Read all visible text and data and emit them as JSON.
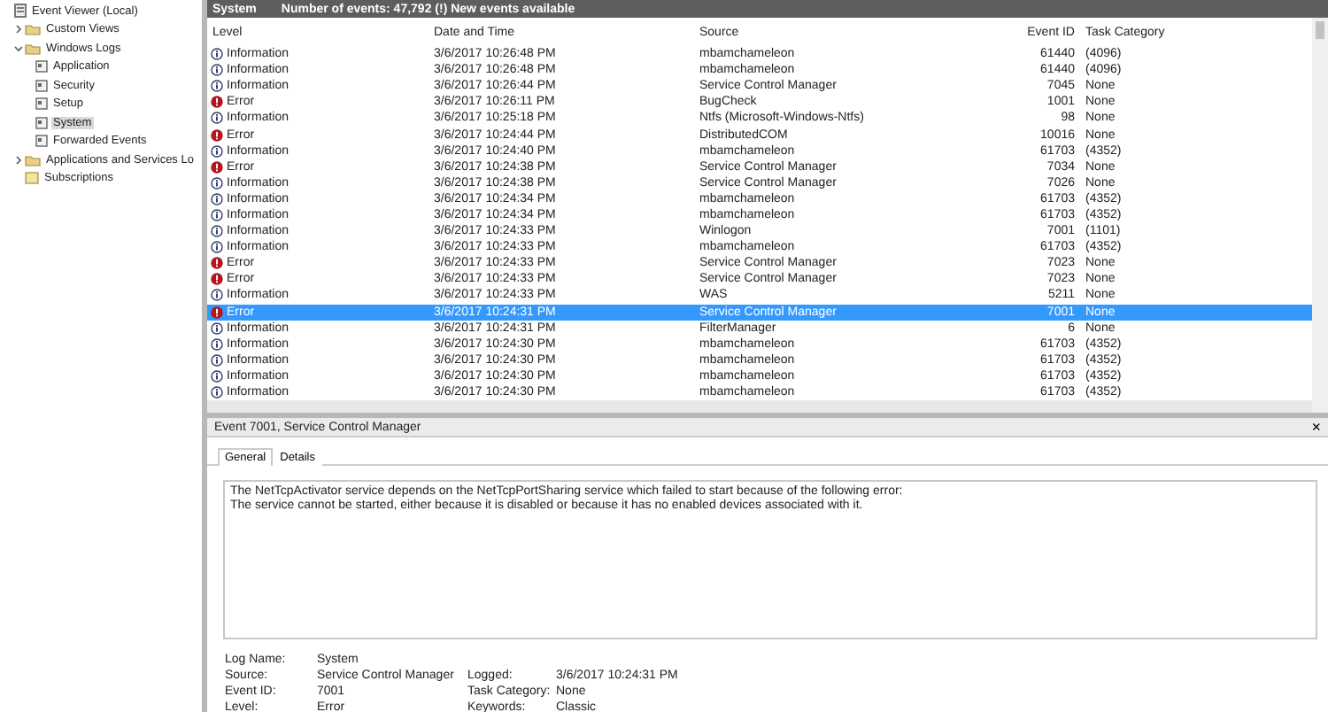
{
  "tree": [
    {
      "label": "Event Viewer (Local)",
      "kind": "viewer",
      "children": [
        {
          "label": "Custom Views",
          "kind": "folder",
          "expanded": false
        },
        {
          "label": "Windows Logs",
          "kind": "folder",
          "expanded": true,
          "children": [
            {
              "label": "Application",
              "kind": "log",
              "selected": false
            },
            {
              "label": "Security",
              "kind": "log",
              "selected": false
            },
            {
              "label": "Setup",
              "kind": "log",
              "selected": false
            },
            {
              "label": "System",
              "kind": "log",
              "selected": true
            },
            {
              "label": "Forwarded Events",
              "kind": "log",
              "selected": false
            }
          ]
        },
        {
          "label": "Applications and Services Lo",
          "kind": "folder",
          "expanded": false
        },
        {
          "label": "Subscriptions",
          "kind": "subscriptions"
        }
      ]
    }
  ],
  "list_header": {
    "title": "System",
    "summary": "Number of events: 47,792 (!) New events available"
  },
  "columns": [
    "Level",
    "Date and Time",
    "Source",
    "Event ID",
    "Task Category"
  ],
  "rows": [
    {
      "kind": "info",
      "level": "Information",
      "time": "3/6/2017 10:26:48 PM",
      "source": "mbamchameleon",
      "id": "61440",
      "category": "(4096)",
      "selected": false
    },
    {
      "kind": "info",
      "level": "Information",
      "time": "3/6/2017 10:26:48 PM",
      "source": "mbamchameleon",
      "id": "61440",
      "category": "(4096)",
      "selected": false
    },
    {
      "kind": "info",
      "level": "Information",
      "time": "3/6/2017 10:26:44 PM",
      "source": "Service Control Manager",
      "id": "7045",
      "category": "None",
      "selected": false
    },
    {
      "kind": "error",
      "level": "Error",
      "time": "3/6/2017 10:26:11 PM",
      "source": "BugCheck",
      "id": "1001",
      "category": "None",
      "selected": false
    },
    {
      "kind": "info",
      "level": "Information",
      "time": "3/6/2017 10:25:18 PM",
      "source": "Ntfs (Microsoft-Windows-Ntfs)",
      "id": "98",
      "category": "None",
      "selected": false
    },
    {
      "kind": "error",
      "level": "Error",
      "time": "3/6/2017 10:24:44 PM",
      "source": "DistributedCOM",
      "id": "10016",
      "category": "None",
      "selected": false
    },
    {
      "kind": "info",
      "level": "Information",
      "time": "3/6/2017 10:24:40 PM",
      "source": "mbamchameleon",
      "id": "61703",
      "category": "(4352)",
      "selected": false
    },
    {
      "kind": "error",
      "level": "Error",
      "time": "3/6/2017 10:24:38 PM",
      "source": "Service Control Manager",
      "id": "7034",
      "category": "None",
      "selected": false
    },
    {
      "kind": "info",
      "level": "Information",
      "time": "3/6/2017 10:24:38 PM",
      "source": "Service Control Manager",
      "id": "7026",
      "category": "None",
      "selected": false
    },
    {
      "kind": "info",
      "level": "Information",
      "time": "3/6/2017 10:24:34 PM",
      "source": "mbamchameleon",
      "id": "61703",
      "category": "(4352)",
      "selected": false
    },
    {
      "kind": "info",
      "level": "Information",
      "time": "3/6/2017 10:24:34 PM",
      "source": "mbamchameleon",
      "id": "61703",
      "category": "(4352)",
      "selected": false
    },
    {
      "kind": "info",
      "level": "Information",
      "time": "3/6/2017 10:24:33 PM",
      "source": "Winlogon",
      "id": "7001",
      "category": "(1101)",
      "selected": false
    },
    {
      "kind": "info",
      "level": "Information",
      "time": "3/6/2017 10:24:33 PM",
      "source": "mbamchameleon",
      "id": "61703",
      "category": "(4352)",
      "selected": false
    },
    {
      "kind": "error",
      "level": "Error",
      "time": "3/6/2017 10:24:33 PM",
      "source": "Service Control Manager",
      "id": "7023",
      "category": "None",
      "selected": false
    },
    {
      "kind": "error",
      "level": "Error",
      "time": "3/6/2017 10:24:33 PM",
      "source": "Service Control Manager",
      "id": "7023",
      "category": "None",
      "selected": false
    },
    {
      "kind": "info",
      "level": "Information",
      "time": "3/6/2017 10:24:33 PM",
      "source": "WAS",
      "id": "5211",
      "category": "None",
      "selected": false
    },
    {
      "kind": "error",
      "level": "Error",
      "time": "3/6/2017 10:24:31 PM",
      "source": "Service Control Manager",
      "id": "7001",
      "category": "None",
      "selected": true
    },
    {
      "kind": "info",
      "level": "Information",
      "time": "3/6/2017 10:24:31 PM",
      "source": "FilterManager",
      "id": "6",
      "category": "None",
      "selected": false
    },
    {
      "kind": "info",
      "level": "Information",
      "time": "3/6/2017 10:24:30 PM",
      "source": "mbamchameleon",
      "id": "61703",
      "category": "(4352)",
      "selected": false
    },
    {
      "kind": "info",
      "level": "Information",
      "time": "3/6/2017 10:24:30 PM",
      "source": "mbamchameleon",
      "id": "61703",
      "category": "(4352)",
      "selected": false
    },
    {
      "kind": "info",
      "level": "Information",
      "time": "3/6/2017 10:24:30 PM",
      "source": "mbamchameleon",
      "id": "61703",
      "category": "(4352)",
      "selected": false
    },
    {
      "kind": "info",
      "level": "Information",
      "time": "3/6/2017 10:24:30 PM",
      "source": "mbamchameleon",
      "id": "61703",
      "category": "(4352)",
      "selected": false
    }
  ],
  "detail": {
    "title": "Event 7001, Service Control Manager",
    "close": "×",
    "tabs": [
      {
        "label": "General",
        "selected": true
      },
      {
        "label": "Details",
        "selected": false
      }
    ],
    "message": [
      "The NetTcpActivator service depends on the NetTcpPortSharing service which failed to start because of the following error:",
      "The service cannot be started, either because it is disabled or because it has no enabled devices associated with it."
    ],
    "properties": [
      [
        {
          "label": "Log Name:",
          "value": "System"
        }
      ],
      [
        {
          "label": "Source:",
          "value": "Service Control Manager"
        },
        {
          "label": "Logged:",
          "value": "3/6/2017 10:24:31 PM"
        }
      ],
      [
        {
          "label": "Event ID:",
          "value": "7001"
        },
        {
          "label": "Task Category:",
          "value": "None"
        }
      ],
      [
        {
          "label": "Level:",
          "value": "Error"
        },
        {
          "label": "Keywords:",
          "value": "Classic"
        }
      ]
    ]
  }
}
